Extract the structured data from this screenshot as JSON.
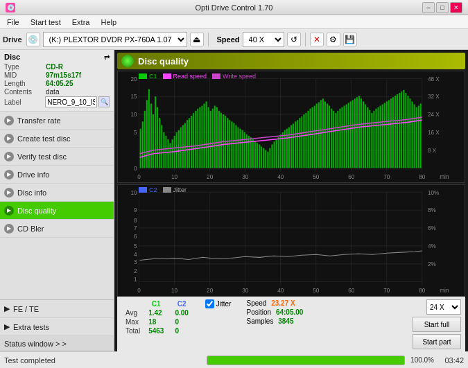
{
  "window": {
    "title": "Opti Drive Control 1.70",
    "icon": "💿"
  },
  "menu": {
    "items": [
      "File",
      "Start test",
      "Extra",
      "Help"
    ]
  },
  "toolbar": {
    "drive_label": "Drive",
    "drive_value": "(K:)  PLEXTOR DVDR  PX-760A 1.07",
    "speed_label": "Speed",
    "speed_value": "40 X"
  },
  "sidebar": {
    "disc_section": {
      "title": "Disc",
      "type_label": "Type",
      "type_value": "CD-R",
      "mid_label": "MID",
      "mid_value": "97m15s17f",
      "length_label": "Length",
      "length_value": "64:05.25",
      "contents_label": "Contents",
      "contents_value": "data",
      "label_label": "Label",
      "label_value": "NERO_9_10_IS"
    },
    "nav_items": [
      {
        "id": "transfer-rate",
        "label": "Transfer rate",
        "active": false
      },
      {
        "id": "create-test-disc",
        "label": "Create test disc",
        "active": false
      },
      {
        "id": "verify-test-disc",
        "label": "Verify test disc",
        "active": false
      },
      {
        "id": "drive-info",
        "label": "Drive info",
        "active": false
      },
      {
        "id": "disc-info",
        "label": "Disc info",
        "active": false
      },
      {
        "id": "disc-quality",
        "label": "Disc quality",
        "active": true
      },
      {
        "id": "cd-bler",
        "label": "CD Bler",
        "active": false
      }
    ],
    "fe_te": "FE / TE",
    "extra_tests": "Extra tests",
    "status_window": "Status window > >"
  },
  "content": {
    "section_title": "Disc quality",
    "legend": {
      "c1_label": "C1",
      "read_speed_label": "Read speed",
      "write_speed_label": "Write speed",
      "c2_label": "C2",
      "jitter_label": "Jitter"
    },
    "upper_chart": {
      "y_max": 20,
      "x_max": 80,
      "y_right_labels": [
        "48 X",
        "32 X",
        "24 X",
        "16 X",
        "8 X"
      ],
      "x_labels": [
        "0",
        "10",
        "20",
        "30",
        "40",
        "50",
        "60",
        "70",
        "80"
      ],
      "unit": "min"
    },
    "lower_chart": {
      "y_max": 10,
      "x_max": 80,
      "y_right_labels": [
        "10%",
        "8%",
        "6%",
        "4%",
        "2%"
      ],
      "x_labels": [
        "0",
        "10",
        "20",
        "30",
        "40",
        "50",
        "60",
        "70",
        "80"
      ],
      "unit": "min"
    }
  },
  "stats": {
    "headers": [
      "C1",
      "C2"
    ],
    "avg_label": "Avg",
    "avg_c1": "1.42",
    "avg_c2": "0.00",
    "max_label": "Max",
    "max_c1": "18",
    "max_c2": "0",
    "total_label": "Total",
    "total_c1": "5463",
    "total_c2": "0",
    "jitter_label": "Jitter",
    "speed_label": "Speed",
    "speed_value": "23.27 X",
    "position_label": "Position",
    "position_value": "64:05.00",
    "samples_label": "Samples",
    "samples_value": "3845",
    "speed_dropdown": "24 X",
    "btn_start_full": "Start full",
    "btn_start_part": "Start part"
  },
  "statusbar": {
    "status_text": "Test completed",
    "progress": 100.0,
    "progress_label": "100.0%",
    "time": "03:42"
  },
  "colors": {
    "accent_green": "#44cc00",
    "c1_green": "#00cc00",
    "read_speed_magenta": "#ff44ff",
    "write_speed_magenta": "#cc00cc",
    "c2_label": "#4466ff",
    "jitter_color": "#aaaaaa",
    "orange": "#ff6600"
  }
}
